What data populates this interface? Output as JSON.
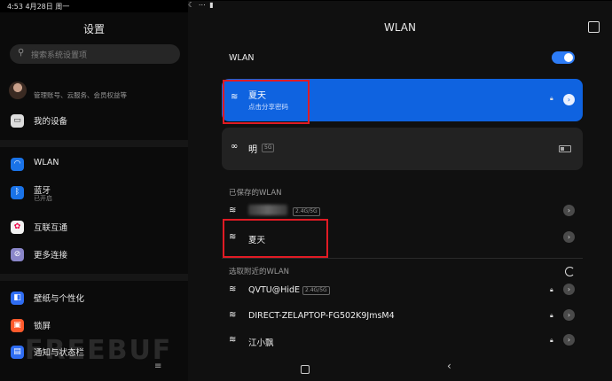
{
  "status_bar": {
    "time": "4:53 4月28日 周一",
    "icons": "☾ ⋯ ▮"
  },
  "settings": {
    "title": "设置",
    "search_placeholder": "搜索系统设置项",
    "account_sub": "管理账号、云服务、会员权益等",
    "my_device": "我的设备",
    "items": [
      {
        "label": "WLAN",
        "color": "#1a73e8",
        "icon": "wifi-icon"
      },
      {
        "label": "蓝牙",
        "sub": "已开启",
        "color": "#1a73e8",
        "icon": "bluetooth-icon"
      },
      {
        "label": "互联互通",
        "color": "#ffffff",
        "icon": "interconnect-icon"
      },
      {
        "label": "更多连接",
        "color": "#8a86c9",
        "icon": "link-icon"
      },
      {
        "label": "壁纸与个性化",
        "color": "#2f6df2",
        "icon": "wallpaper-icon"
      },
      {
        "label": "锁屏",
        "color": "#ff5a2c",
        "icon": "lock-icon"
      },
      {
        "label": "通知与状态栏",
        "color": "#2f6df2",
        "icon": "notification-icon"
      }
    ]
  },
  "wlan": {
    "title": "WLAN",
    "toggle_label": "WLAN",
    "toggle_on": true,
    "connected": {
      "ssid": "夏天",
      "hint": "点击分享密码"
    },
    "hotspot": {
      "ssid": "明",
      "band": "5G"
    },
    "saved_header": "已保存的WLAN",
    "saved": [
      {
        "ssid": "",
        "band": "2.4G/5G"
      },
      {
        "ssid": "夏天"
      }
    ],
    "nearby_header": "选取附近的WLAN",
    "nearby": [
      {
        "ssid": "QVTU@HidE",
        "band": "2.4G/5G"
      },
      {
        "ssid": "DIRECT-ZELAPTOP-FG502K9JmsM4"
      },
      {
        "ssid": "江小飘"
      }
    ]
  },
  "watermark": "FREEBUF"
}
